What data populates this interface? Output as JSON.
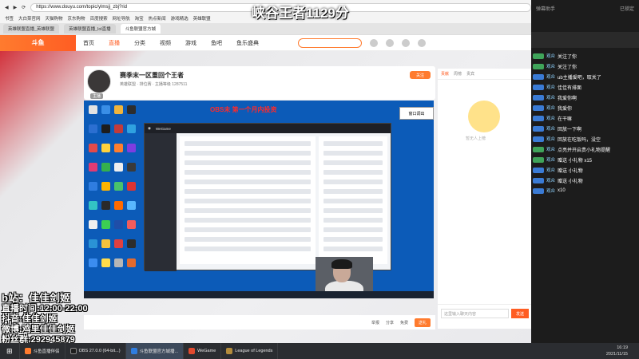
{
  "overlay_title": "峡谷王者1129分",
  "browser": {
    "address": "https://www.douyu.com/topic/ylmsjj_zbj?rid",
    "bookmarks": [
      "书签",
      "大白菜官网",
      "天猫购物",
      "京东购物",
      "百度搜索",
      "网址导航",
      "淘宝",
      "热点新闻",
      "游戏精选",
      "英雄联盟"
    ],
    "tabs": [
      "英雄联盟直播_英雄联盟",
      "英雄联盟直播_lol直播",
      "斗鱼联盟官方城"
    ],
    "active_tab_index": 2
  },
  "site": {
    "logo": "斗鱼",
    "nav": [
      "首页",
      "直播",
      "分类",
      "视频",
      "游戏",
      "鱼吧",
      "鱼乐盛典"
    ],
    "active_nav_index": 1
  },
  "room": {
    "title": "赛季末一区重回个王者",
    "subtitle": "英雄联盟 · 排位赛 · 主播等级 1287511",
    "follow": "关注",
    "host_tag": "主播"
  },
  "video": {
    "obs_text": "OBS未 第一个月内投资",
    "popup": "窗口调出"
  },
  "controls": {
    "items": [
      "举报",
      "分享",
      "免费",
      "送礼"
    ]
  },
  "right_panel": {
    "tabs": [
      "贡献",
      "周榜",
      "贵宾"
    ],
    "active_tab_index": 0,
    "sticker_text": "暂无人上榜",
    "chat_placeholder": "这里输入聊天内容",
    "send_label": "发送"
  },
  "danmu": {
    "header_left": "弹幕助手",
    "header_right": "已锁定",
    "messages": [
      {
        "name": "观众",
        "text": "关注了你"
      },
      {
        "name": "观众",
        "text": "关注了你"
      },
      {
        "name": "观众",
        "text": "ub主播爱吧，取关了"
      },
      {
        "name": "观众",
        "text": "佳佳有排面"
      },
      {
        "name": "观众",
        "text": "我爱你啊"
      },
      {
        "name": "观众",
        "text": "我爱你"
      },
      {
        "name": "观众",
        "text": "在干嘛"
      },
      {
        "name": "观众",
        "text": "回放一下啊"
      },
      {
        "name": "观众",
        "text": "回放在吃饭吗，没空"
      },
      {
        "name": "观众",
        "text": "点亮并开启贵小礼物提醒"
      },
      {
        "name": "观众",
        "text": "赠送 小礼物 x15"
      },
      {
        "name": "观众",
        "text": "赠送 小礼物"
      },
      {
        "name": "观众",
        "text": "赠送 小礼物"
      },
      {
        "name": "观众",
        "text": "x10"
      }
    ]
  },
  "stream_info": {
    "bilibili": "b站：佳佳剑姬",
    "schedule": "直播时间:12:00-22:00",
    "douyin": "抖音:佳佳剑姬",
    "weibo": "微博:鸡里佳佳剑姬",
    "fan_group": "粉丝群:292945879"
  },
  "taskbar": {
    "items": [
      "斗鱼直播伴侣",
      "OBS 27.0.0 (64-bit...)",
      "斗鱼联盟官方城播...",
      "WeGame",
      "League of Legends"
    ],
    "active_index": 2,
    "time": "16:19",
    "date": "2021/11/15"
  }
}
